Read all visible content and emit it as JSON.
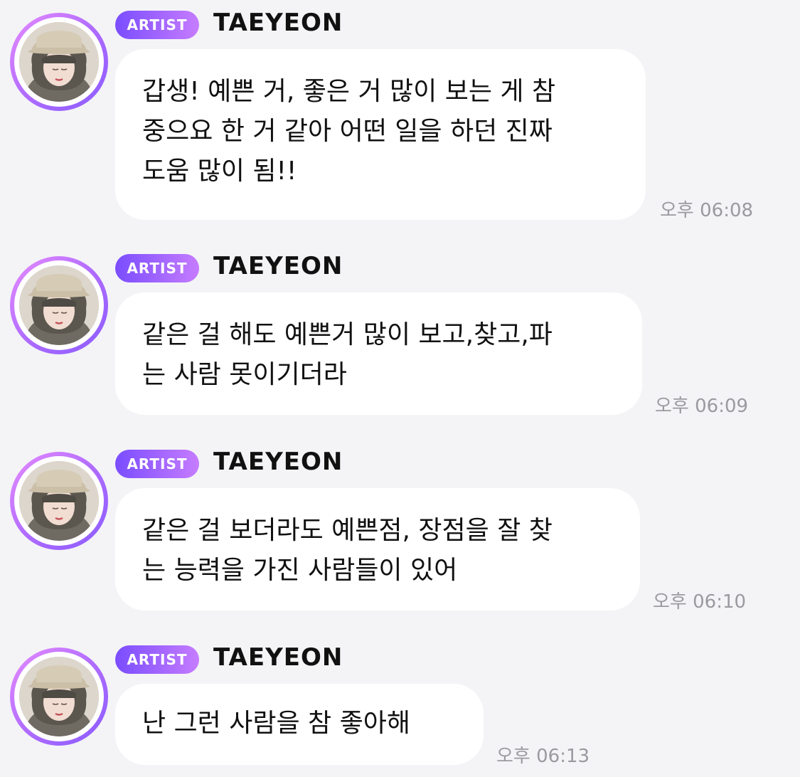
{
  "messages": [
    {
      "badge": "ARTIST",
      "sender": "TAEYEON",
      "text": "갑생! 예쁜 거, 좋은 거 많이 보는 게 참\n중으요 한 거 같아 어떤 일을 하던 진짜\n도움 많이 됨!!",
      "time": "오후 06:08"
    },
    {
      "badge": "ARTIST",
      "sender": "TAEYEON",
      "text": "같은 걸 해도 예쁜거 많이 보고,찾고,파\n는 사람 못이기더라",
      "time": "오후 06:09"
    },
    {
      "badge": "ARTIST",
      "sender": "TAEYEON",
      "text": "같은 걸 보더라도 예쁜점, 장점을 잘 찾\n는 능력을 가진 사람들이 있어",
      "time": "오후 06:10"
    },
    {
      "badge": "ARTIST",
      "sender": "TAEYEON",
      "text": "난 그런 사람을 참 좋아해",
      "time": "오후 06:13"
    }
  ],
  "colors": {
    "background": "#f4f4f6",
    "bubble": "#ffffff",
    "badge_gradient_start": "#7a4dff",
    "badge_gradient_end": "#c67cff",
    "timestamp": "#9a9aa0"
  },
  "icons": {
    "avatar": "profile-photo"
  }
}
